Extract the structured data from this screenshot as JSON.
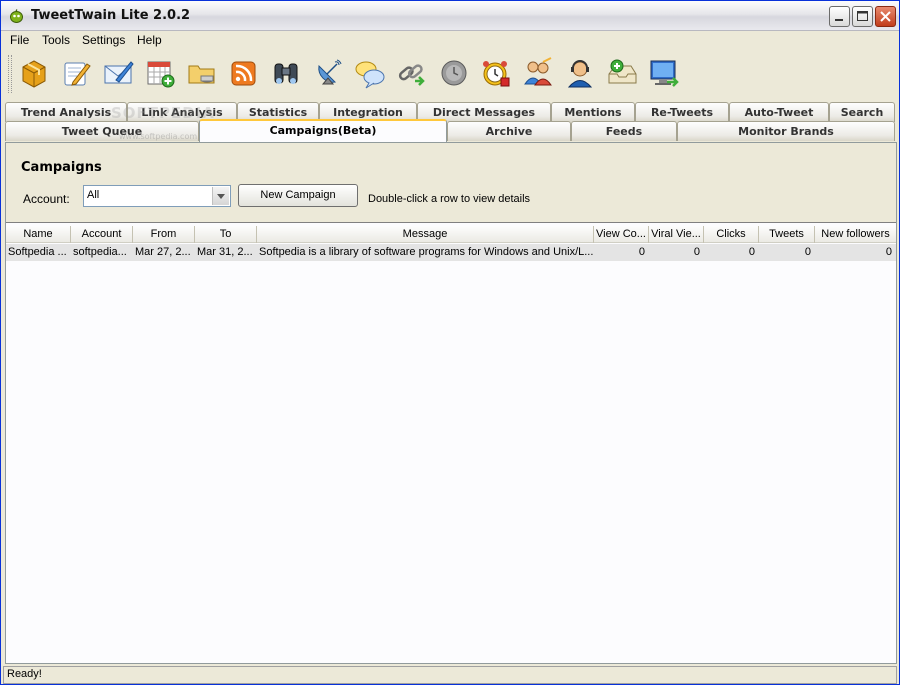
{
  "window": {
    "title": "TweetTwain Lite 2.0.2"
  },
  "menu": {
    "items": [
      "File",
      "Tools",
      "Settings",
      "Help"
    ]
  },
  "toolbar": {
    "icons": [
      "package-icon",
      "compose-icon",
      "mail-icon",
      "calendar-add-icon",
      "folder-icon",
      "rss-icon",
      "binoculars-icon",
      "satellite-dish-icon",
      "chat-bubbles-icon",
      "link-icon",
      "clock-gray-icon",
      "alarm-clock-icon",
      "users-icon",
      "support-agent-icon",
      "tray-add-icon",
      "monitor-arrow-icon"
    ]
  },
  "tabs": {
    "row1": [
      "Trend Analysis",
      "Link Analysis",
      "Statistics",
      "Integration",
      "Direct Messages",
      "Mentions",
      "Re-Tweets",
      "Auto-Tweet",
      "Search"
    ],
    "row2": [
      "Tweet Queue",
      "Campaigns(Beta)",
      "Archive",
      "Feeds",
      "Monitor Brands"
    ],
    "active": "Campaigns(Beta)"
  },
  "watermark": {
    "main": "SOFTPEDIA",
    "sub": "www.softpedia.com"
  },
  "campaigns": {
    "title": "Campaigns",
    "account_label": "Account:",
    "account_value": "All",
    "new_campaign_label": "New Campaign",
    "hint": "Double-click a row to view details"
  },
  "table": {
    "columns": [
      "Name",
      "Account",
      "From",
      "To",
      "Message",
      "View Co...",
      "Viral Vie...",
      "Clicks",
      "Tweets",
      "New followers"
    ],
    "rows": [
      [
        "Softpedia ...",
        "softpedia...",
        "Mar 27, 2...",
        "Mar 31, 2...",
        "Softpedia is a library of software programs for Windows and Unix/L...",
        "0",
        "0",
        "0",
        "0",
        "0"
      ]
    ]
  },
  "status": {
    "text": "Ready!"
  },
  "colors": {
    "titlebar": "#dcdce2",
    "tab_active_accent": "#ffc83c",
    "selected_row": "#e4e4e4"
  }
}
